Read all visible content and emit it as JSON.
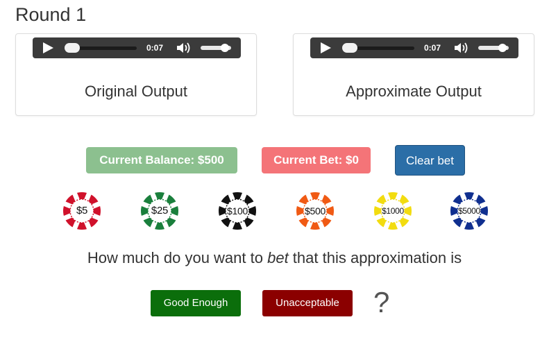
{
  "round": {
    "title": "Round 1"
  },
  "outputs": [
    {
      "label": "Original Output",
      "player": {
        "time": "0:07",
        "progress": 0.0,
        "volume": 0.85
      }
    },
    {
      "label": "Approximate Output",
      "player": {
        "time": "0:07",
        "progress": 0.0,
        "volume": 0.85
      }
    }
  ],
  "status": {
    "balance_label": "Current Balance: $500",
    "bet_label": "Current Bet: $0",
    "clear_label": "Clear bet",
    "balance_color": "#8cc08f",
    "bet_color": "#f47478",
    "clear_color": "#2b6ea7"
  },
  "chips": [
    {
      "label": "$5",
      "color": "#d0112b"
    },
    {
      "label": "$25",
      "color": "#1a7f3c"
    },
    {
      "label": "$100",
      "color": "#111111"
    },
    {
      "label": "$500",
      "color": "#f05a14"
    },
    {
      "label": "$1000",
      "color": "#f2dc0f"
    },
    {
      "label": "$5000",
      "color": "#102f8f"
    }
  ],
  "question": {
    "before": "How much do you want to ",
    "emphasis": "bet",
    "after": " that this approximation is"
  },
  "answers": {
    "good_label": "Good Enough",
    "bad_label": "Unacceptable",
    "good_color": "#0b6e0b",
    "bad_color": "#8b0000",
    "suffix": "?"
  },
  "icons": [
    "play-icon",
    "volume-icon"
  ]
}
